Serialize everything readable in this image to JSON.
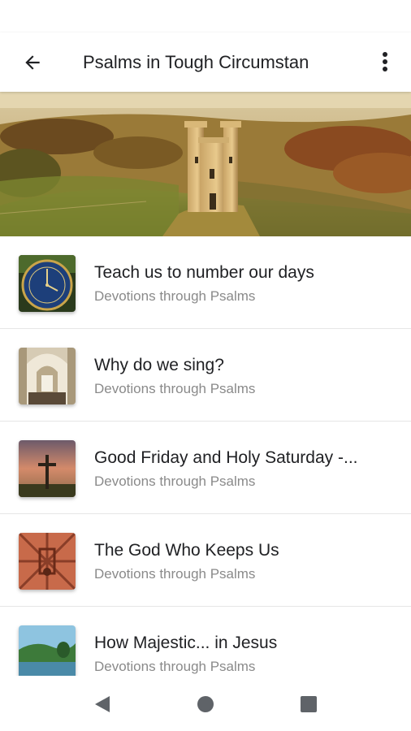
{
  "header": {
    "title": "Psalms in Tough Circumstan",
    "back_icon": "arrow-back-icon",
    "more_icon": "more-vert-icon"
  },
  "hero": {
    "image": "castle-tower-countryside"
  },
  "items": [
    {
      "title": "Teach us to number our days",
      "subtitle": "Devotions through Psalms",
      "thumb": "clock-face"
    },
    {
      "title": "Why do we sing?",
      "subtitle": "Devotions through Psalms",
      "thumb": "church-interior"
    },
    {
      "title": "Good Friday and Holy Saturday -...",
      "subtitle": "Devotions through Psalms",
      "thumb": "cross-sunset"
    },
    {
      "title": "The God Who Keeps Us",
      "subtitle": "Devotions through Psalms",
      "thumb": "ornate-door"
    },
    {
      "title": "How Majestic... in Jesus",
      "subtitle": "Devotions through Psalms",
      "thumb": "lake-landscape"
    }
  ],
  "navbar": {
    "back": "triangle-back-icon",
    "home": "circle-home-icon",
    "recents": "square-recents-icon"
  },
  "colors": {
    "text_primary": "#202124",
    "text_secondary": "#8a8a8a",
    "divider": "#e6e6e6",
    "nav_icon": "#5f6368"
  }
}
